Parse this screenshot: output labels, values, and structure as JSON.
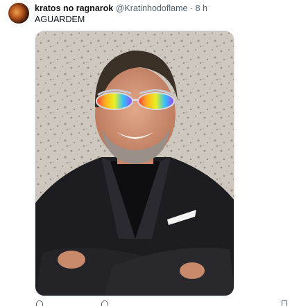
{
  "tweet": {
    "display_name": "kratos no ragnarok",
    "handle": "@Kratinhodoflame",
    "separator": "·",
    "time": "8 h",
    "text": "AGUARDEM",
    "avatar_icon": "profile-avatar",
    "media_description_icon": "photo"
  },
  "actions": {
    "icons": [
      "reply-icon",
      "retweet-icon",
      "share-icon"
    ]
  }
}
